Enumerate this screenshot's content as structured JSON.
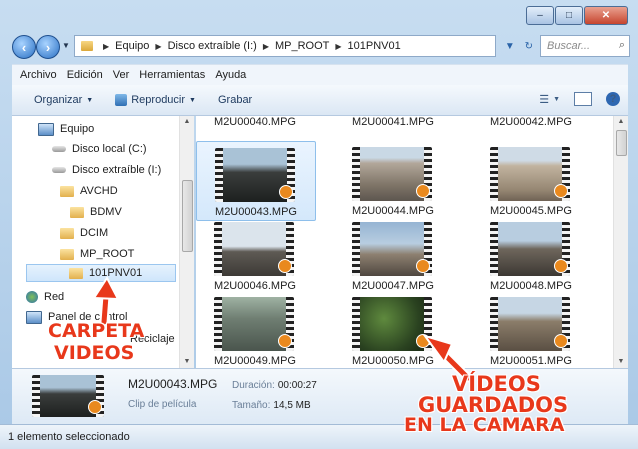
{
  "window": {
    "minimize": "–",
    "maximize": "□",
    "close": "✕"
  },
  "address": {
    "crumbs": [
      "Equipo",
      "Disco extraíble (I:)",
      "MP_ROOT",
      "101PNV01"
    ],
    "search_placeholder": "Buscar..."
  },
  "menu": [
    "Archivo",
    "Edición",
    "Ver",
    "Herramientas",
    "Ayuda"
  ],
  "commands": {
    "organize": "Organizar",
    "play": "Reproducir",
    "burn": "Grabar"
  },
  "nav": {
    "items": [
      {
        "label": "Equipo",
        "icon": "computer-icon"
      },
      {
        "label": "Disco local (C:)",
        "icon": "disk-icon"
      },
      {
        "label": "Disco extraíble (I:)",
        "icon": "disk-icon"
      },
      {
        "label": "AVCHD",
        "icon": "folder-icon"
      },
      {
        "label": "BDMV",
        "icon": "folder-icon"
      },
      {
        "label": "DCIM",
        "icon": "folder-icon"
      },
      {
        "label": "MP_ROOT",
        "icon": "folder-icon"
      },
      {
        "label": "101PNV01",
        "icon": "folder-icon"
      },
      {
        "label": "Red",
        "icon": "network-icon"
      },
      {
        "label": "Panel de control",
        "icon": "control-panel-icon"
      },
      {
        "label": "Reciclaje",
        "icon": "recycle-icon"
      }
    ]
  },
  "files": {
    "top_row": [
      "M2U00040.MPG",
      "M2U00041.MPG",
      "M2U00042.MPG"
    ],
    "grid": [
      "M2U00043.MPG",
      "M2U00044.MPG",
      "M2U00045.MPG",
      "M2U00046.MPG",
      "M2U00047.MPG",
      "M2U00048.MPG",
      "M2U00049.MPG",
      "M2U00050.MPG",
      "M2U00051.MPG"
    ],
    "selected": "M2U00043.MPG"
  },
  "details": {
    "name": "M2U00043.MPG",
    "type": "Clip de película",
    "duration_label": "Duración:",
    "duration_value": "00:00:27",
    "size_label": "Tamaño:",
    "size_value": "14,5 MB"
  },
  "status": "1 elemento seleccionado",
  "annotations": {
    "folder_line1": "CARPETA",
    "folder_line2": "VIDEOS",
    "videos_line1": "VÍDEOS",
    "videos_line2": "GUARDADOS",
    "videos_line3": "EN LA CAMARA",
    "color": "#e8381b"
  }
}
